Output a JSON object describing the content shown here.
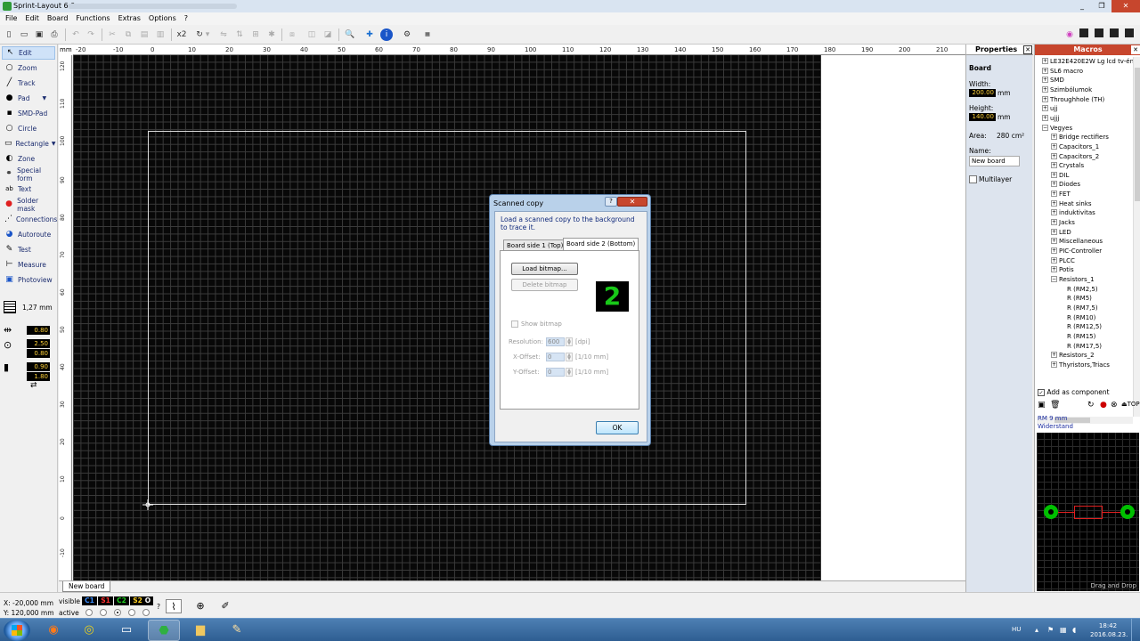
{
  "window": {
    "title": "Sprint-Layout 6.0",
    "controls": [
      "_",
      "❐",
      "✕"
    ]
  },
  "menu": [
    "File",
    "Edit",
    "Board",
    "Functions",
    "Extras",
    "Options",
    "?"
  ],
  "toolbar": {
    "zoom_x2": "x2"
  },
  "tools": [
    {
      "label": "Edit",
      "icon": "pointer-icon"
    },
    {
      "label": "Zoom",
      "icon": "magnifier-icon"
    },
    {
      "label": "Track",
      "icon": "track-icon"
    },
    {
      "label": "Pad",
      "icon": "pad-icon"
    },
    {
      "label": "SMD-Pad",
      "icon": "smd-pad-icon"
    },
    {
      "label": "Circle",
      "icon": "circle-icon"
    },
    {
      "label": "Rectangle",
      "icon": "rectangle-icon"
    },
    {
      "label": "Zone",
      "icon": "zone-icon"
    },
    {
      "label": "Special form",
      "icon": "special-form-icon"
    },
    {
      "label": "Text",
      "icon": "text-icon"
    },
    {
      "label": "Solder mask",
      "icon": "solder-mask-icon"
    },
    {
      "label": "Connections",
      "icon": "connections-icon"
    },
    {
      "label": "Autoroute",
      "icon": "autoroute-icon"
    },
    {
      "label": "Test",
      "icon": "test-icon"
    },
    {
      "label": "Measure",
      "icon": "measure-icon"
    },
    {
      "label": "Photoview",
      "icon": "photoview-icon"
    }
  ],
  "grid": {
    "value": "1,27 mm"
  },
  "track_width": "0.80",
  "pad_outer": "2.50",
  "pad_inner": "0.80",
  "smd_w": "0.90",
  "smd_h": "1.80",
  "ruler": {
    "unit": "mm",
    "top": [
      "-20",
      "-10",
      "0",
      "10",
      "20",
      "30",
      "40",
      "50",
      "60",
      "70",
      "80",
      "90",
      "100",
      "110",
      "120",
      "130",
      "140",
      "150",
      "160",
      "170",
      "180",
      "190",
      "200",
      "210"
    ],
    "left": [
      "120",
      "110",
      "100",
      "90",
      "80",
      "70",
      "60",
      "50",
      "40",
      "30",
      "20",
      "10",
      "0",
      "-10"
    ]
  },
  "board_tab": "New board",
  "status": {
    "x": "X:  -20,000 mm",
    "y": "Y:  120,000 mm",
    "visible": "visible",
    "active": "active",
    "layers": [
      {
        "label": "C1",
        "color": "#3a8cff"
      },
      {
        "label": "S1",
        "color": "#ff3030"
      },
      {
        "label": "C2",
        "color": "#20d020"
      },
      {
        "label": "S2",
        "color": "#ffd020"
      },
      {
        "label": "O",
        "color": "#ffffff"
      }
    ],
    "question": "?"
  },
  "properties": {
    "title": "Properties",
    "section": "Board",
    "width_label": "Width:",
    "width_value": "200.00",
    "height_label": "Height:",
    "height_value": "140.00",
    "unit": "mm",
    "area_label": "Area:",
    "area_value": "280 cm²",
    "name_label": "Name:",
    "name_value": "New board",
    "multilayer": "Multilayer"
  },
  "macros": {
    "title": "Macros",
    "tree": [
      {
        "label": "LE32E420E2W Lg lcd tv-énk",
        "level": 0,
        "sign": "+"
      },
      {
        "label": "SL6 macro",
        "level": 0,
        "sign": "+"
      },
      {
        "label": "SMD",
        "level": 0,
        "sign": "+"
      },
      {
        "label": "Szimbólumok",
        "level": 0,
        "sign": "+"
      },
      {
        "label": "Throughhole (TH)",
        "level": 0,
        "sign": "+"
      },
      {
        "label": "ujj",
        "level": 0,
        "sign": "+"
      },
      {
        "label": "ujjj",
        "level": 0,
        "sign": "+"
      },
      {
        "label": "Vegyes",
        "level": 0,
        "sign": "−"
      },
      {
        "label": "Bridge rectifiers",
        "level": 1,
        "sign": "+"
      },
      {
        "label": "Capacitors_1",
        "level": 1,
        "sign": "+"
      },
      {
        "label": "Capacitors_2",
        "level": 1,
        "sign": "+"
      },
      {
        "label": "Crystals",
        "level": 1,
        "sign": "+"
      },
      {
        "label": "DIL",
        "level": 1,
        "sign": "+"
      },
      {
        "label": "Diodes",
        "level": 1,
        "sign": "+"
      },
      {
        "label": "FET",
        "level": 1,
        "sign": "+"
      },
      {
        "label": "Heat sinks",
        "level": 1,
        "sign": "+"
      },
      {
        "label": "induktivitas",
        "level": 1,
        "sign": "+"
      },
      {
        "label": "Jacks",
        "level": 1,
        "sign": "+"
      },
      {
        "label": "LED",
        "level": 1,
        "sign": "+"
      },
      {
        "label": "Miscellaneous",
        "level": 1,
        "sign": "+"
      },
      {
        "label": "PIC-Controller",
        "level": 1,
        "sign": "+"
      },
      {
        "label": "PLCC",
        "level": 1,
        "sign": "+"
      },
      {
        "label": "Potis",
        "level": 1,
        "sign": "+"
      },
      {
        "label": "Resistors_1",
        "level": 1,
        "sign": "−"
      },
      {
        "label": "R (RM2,5)",
        "level": 2,
        "sign": ""
      },
      {
        "label": "R (RM5)",
        "level": 2,
        "sign": ""
      },
      {
        "label": "R (RM7,5)",
        "level": 2,
        "sign": ""
      },
      {
        "label": "R (RM10)",
        "level": 2,
        "sign": ""
      },
      {
        "label": "R (RM12,5)",
        "level": 2,
        "sign": ""
      },
      {
        "label": "R (RM15)",
        "level": 2,
        "sign": ""
      },
      {
        "label": "R (RM17,5)",
        "level": 2,
        "sign": ""
      },
      {
        "label": "Resistors_2",
        "level": 1,
        "sign": "+"
      },
      {
        "label": "Thyristors,Triacs",
        "level": 1,
        "sign": "+"
      }
    ],
    "add_as_component": "Add as component",
    "top_label": "TOP",
    "component_name": "RM 9 mm",
    "component_desc": "Widerstand",
    "drag_drop": "Drag and Drop"
  },
  "dialog": {
    "title": "Scanned copy",
    "help": "?",
    "close": "✕",
    "description": "Load a scanned copy to the background to trace it.",
    "tabs": [
      "Board side 1 (Top)",
      "Board side 2 (Bottom)"
    ],
    "load_button": "Load bitmap...",
    "delete_button": "Delete bitmap",
    "side_number": "2",
    "show_bitmap": "Show bitmap",
    "resolution_label": "Resolution:",
    "resolution_value": "600",
    "resolution_unit": "[dpi]",
    "xoffset_label": "X-Offset:",
    "xoffset_value": "0",
    "yoffset_label": "Y-Offset:",
    "yoffset_value": "0",
    "offset_unit": "[1/10 mm]",
    "ok": "OK"
  },
  "taskbar": {
    "apps": [
      "firefox-icon",
      "chrome-icon",
      "terminal-icon",
      "sprint-layout-icon",
      "explorer-icon",
      "paint-icon"
    ],
    "lang": "HU",
    "time": "18:42",
    "date": "2016.08.23."
  }
}
